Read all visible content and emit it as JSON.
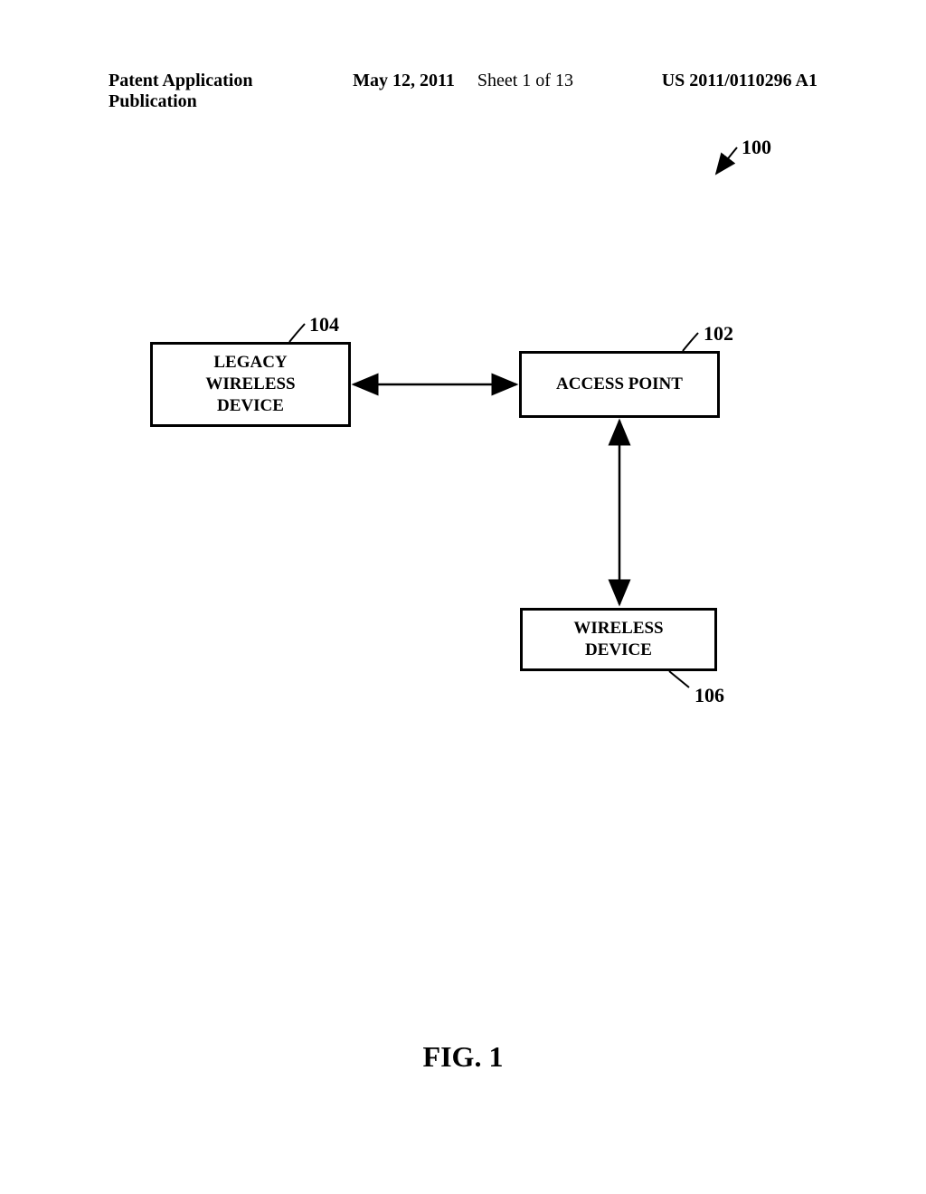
{
  "header": {
    "left": "Patent Application Publication",
    "date": "May 12, 2011",
    "sheet": "Sheet 1 of 13",
    "right": "US 2011/0110296 A1"
  },
  "diagram": {
    "system_ref": "100",
    "legacy_ref": "104",
    "ap_ref": "102",
    "wd_ref": "106",
    "boxes": {
      "legacy_line1": "LEGACY",
      "legacy_line2": "WIRELESS",
      "legacy_line3": "DEVICE",
      "ap_line1": "ACCESS POINT",
      "wd_line1": "WIRELESS",
      "wd_line2": "DEVICE"
    },
    "figure_caption": "FIG. 1"
  }
}
